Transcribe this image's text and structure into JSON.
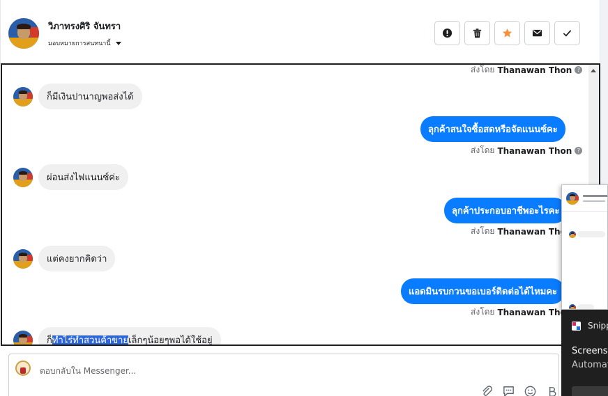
{
  "header": {
    "contact_name": "วิภาทรงศิริ จันทรา",
    "assignment_label": "มอบหมายการสนทนานี้",
    "actions": [
      {
        "name": "report-button",
        "icon": "alert-icon"
      },
      {
        "name": "delete-button",
        "icon": "trash-icon"
      },
      {
        "name": "star-button",
        "icon": "star-icon"
      },
      {
        "name": "mail-button",
        "icon": "envelope-icon"
      },
      {
        "name": "done-button",
        "icon": "checkmark-icon"
      }
    ]
  },
  "chat": {
    "sent_by_prefix": "ส่งโดย",
    "agent_name": "Thanawan Thon",
    "messages": [
      {
        "dir": "in",
        "text": "ก็มีเงินปานาญพอส่งได้"
      },
      {
        "dir": "out",
        "text": "ลุกค้าสนใจซื้อสดหรือจัดแนนซ์คะ"
      },
      {
        "dir": "in",
        "text": "ผ่อนส่งไฟแนนซ์ค่ะ"
      },
      {
        "dir": "out",
        "text": "ลุกค้าประกอบอาชีพอะไรคะ"
      },
      {
        "dir": "in",
        "text": "แต่คงยากคิดว่า"
      },
      {
        "dir": "out",
        "text": "แอดมินรบกวนขอเบอร์ติดต่อได้ไหมคะ"
      },
      {
        "dir": "in",
        "text_before": "ก็",
        "text_highlight": "ทำไร่ทำสวนค้าขาย",
        "text_after": "เล็กๆน้อยๆพอได้ใช้อยู่"
      }
    ]
  },
  "composer": {
    "placeholder": "ตอบกลับใน Messenger..."
  },
  "snip": {
    "app_name": "Snipp",
    "title": "Screensh",
    "subtitle": "Automat"
  },
  "colors": {
    "outgoing_bubble": "#0a7cff",
    "incoming_bubble": "#f0f0f0",
    "star": "#f7923a",
    "text_highlight": "#2f66d6"
  }
}
